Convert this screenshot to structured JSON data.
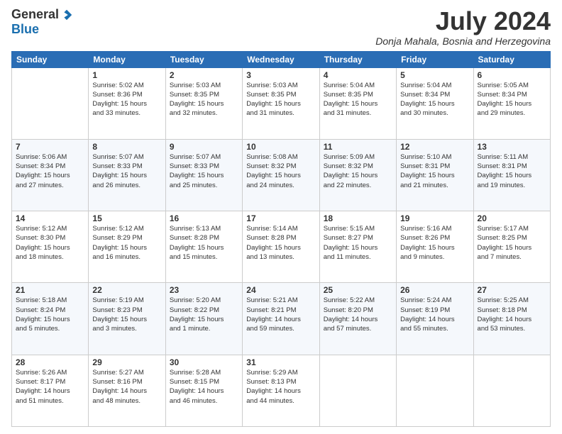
{
  "header": {
    "logo_general": "General",
    "logo_blue": "Blue",
    "month_title": "July 2024",
    "location": "Donja Mahala, Bosnia and Herzegovina"
  },
  "calendar": {
    "headers": [
      "Sunday",
      "Monday",
      "Tuesday",
      "Wednesday",
      "Thursday",
      "Friday",
      "Saturday"
    ],
    "weeks": [
      [
        {
          "day": "",
          "info": ""
        },
        {
          "day": "1",
          "info": "Sunrise: 5:02 AM\nSunset: 8:36 PM\nDaylight: 15 hours\nand 33 minutes."
        },
        {
          "day": "2",
          "info": "Sunrise: 5:03 AM\nSunset: 8:35 PM\nDaylight: 15 hours\nand 32 minutes."
        },
        {
          "day": "3",
          "info": "Sunrise: 5:03 AM\nSunset: 8:35 PM\nDaylight: 15 hours\nand 31 minutes."
        },
        {
          "day": "4",
          "info": "Sunrise: 5:04 AM\nSunset: 8:35 PM\nDaylight: 15 hours\nand 31 minutes."
        },
        {
          "day": "5",
          "info": "Sunrise: 5:04 AM\nSunset: 8:34 PM\nDaylight: 15 hours\nand 30 minutes."
        },
        {
          "day": "6",
          "info": "Sunrise: 5:05 AM\nSunset: 8:34 PM\nDaylight: 15 hours\nand 29 minutes."
        }
      ],
      [
        {
          "day": "7",
          "info": "Sunrise: 5:06 AM\nSunset: 8:34 PM\nDaylight: 15 hours\nand 27 minutes."
        },
        {
          "day": "8",
          "info": "Sunrise: 5:07 AM\nSunset: 8:33 PM\nDaylight: 15 hours\nand 26 minutes."
        },
        {
          "day": "9",
          "info": "Sunrise: 5:07 AM\nSunset: 8:33 PM\nDaylight: 15 hours\nand 25 minutes."
        },
        {
          "day": "10",
          "info": "Sunrise: 5:08 AM\nSunset: 8:32 PM\nDaylight: 15 hours\nand 24 minutes."
        },
        {
          "day": "11",
          "info": "Sunrise: 5:09 AM\nSunset: 8:32 PM\nDaylight: 15 hours\nand 22 minutes."
        },
        {
          "day": "12",
          "info": "Sunrise: 5:10 AM\nSunset: 8:31 PM\nDaylight: 15 hours\nand 21 minutes."
        },
        {
          "day": "13",
          "info": "Sunrise: 5:11 AM\nSunset: 8:31 PM\nDaylight: 15 hours\nand 19 minutes."
        }
      ],
      [
        {
          "day": "14",
          "info": "Sunrise: 5:12 AM\nSunset: 8:30 PM\nDaylight: 15 hours\nand 18 minutes."
        },
        {
          "day": "15",
          "info": "Sunrise: 5:12 AM\nSunset: 8:29 PM\nDaylight: 15 hours\nand 16 minutes."
        },
        {
          "day": "16",
          "info": "Sunrise: 5:13 AM\nSunset: 8:28 PM\nDaylight: 15 hours\nand 15 minutes."
        },
        {
          "day": "17",
          "info": "Sunrise: 5:14 AM\nSunset: 8:28 PM\nDaylight: 15 hours\nand 13 minutes."
        },
        {
          "day": "18",
          "info": "Sunrise: 5:15 AM\nSunset: 8:27 PM\nDaylight: 15 hours\nand 11 minutes."
        },
        {
          "day": "19",
          "info": "Sunrise: 5:16 AM\nSunset: 8:26 PM\nDaylight: 15 hours\nand 9 minutes."
        },
        {
          "day": "20",
          "info": "Sunrise: 5:17 AM\nSunset: 8:25 PM\nDaylight: 15 hours\nand 7 minutes."
        }
      ],
      [
        {
          "day": "21",
          "info": "Sunrise: 5:18 AM\nSunset: 8:24 PM\nDaylight: 15 hours\nand 5 minutes."
        },
        {
          "day": "22",
          "info": "Sunrise: 5:19 AM\nSunset: 8:23 PM\nDaylight: 15 hours\nand 3 minutes."
        },
        {
          "day": "23",
          "info": "Sunrise: 5:20 AM\nSunset: 8:22 PM\nDaylight: 15 hours\nand 1 minute."
        },
        {
          "day": "24",
          "info": "Sunrise: 5:21 AM\nSunset: 8:21 PM\nDaylight: 14 hours\nand 59 minutes."
        },
        {
          "day": "25",
          "info": "Sunrise: 5:22 AM\nSunset: 8:20 PM\nDaylight: 14 hours\nand 57 minutes."
        },
        {
          "day": "26",
          "info": "Sunrise: 5:24 AM\nSunset: 8:19 PM\nDaylight: 14 hours\nand 55 minutes."
        },
        {
          "day": "27",
          "info": "Sunrise: 5:25 AM\nSunset: 8:18 PM\nDaylight: 14 hours\nand 53 minutes."
        }
      ],
      [
        {
          "day": "28",
          "info": "Sunrise: 5:26 AM\nSunset: 8:17 PM\nDaylight: 14 hours\nand 51 minutes."
        },
        {
          "day": "29",
          "info": "Sunrise: 5:27 AM\nSunset: 8:16 PM\nDaylight: 14 hours\nand 48 minutes."
        },
        {
          "day": "30",
          "info": "Sunrise: 5:28 AM\nSunset: 8:15 PM\nDaylight: 14 hours\nand 46 minutes."
        },
        {
          "day": "31",
          "info": "Sunrise: 5:29 AM\nSunset: 8:13 PM\nDaylight: 14 hours\nand 44 minutes."
        },
        {
          "day": "",
          "info": ""
        },
        {
          "day": "",
          "info": ""
        },
        {
          "day": "",
          "info": ""
        }
      ]
    ]
  }
}
